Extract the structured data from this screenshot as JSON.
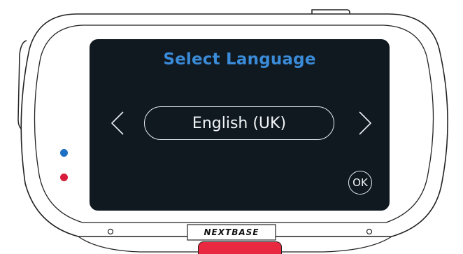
{
  "screen": {
    "title": "Select Language",
    "selected_language": "English (UK)",
    "ok_label": "OK",
    "prev_icon": "chevron-left-icon",
    "next_icon": "chevron-right-icon"
  },
  "device": {
    "brand": "NEXTBASE",
    "indicator_colors": {
      "status_blue": "#1c6fc2",
      "status_red": "#d71d3b"
    },
    "record_button_color": "#e8293f"
  },
  "colors": {
    "title_blue": "#3a8bd8",
    "screen_bg": "#101820",
    "ui_white": "#f2f5f7"
  }
}
